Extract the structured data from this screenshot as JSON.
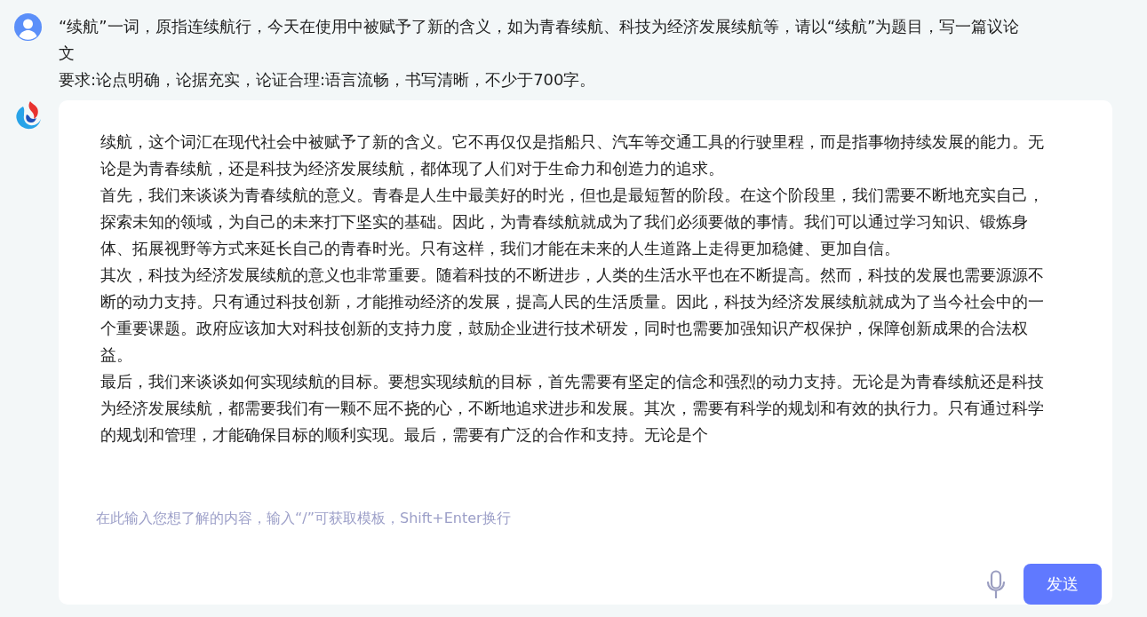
{
  "user_message": {
    "paragraphs": [
      "“续航”一词，原指连续航行，今天在使用中被赋予了新的含义，如为青春续航、科技为经济发展续航等，请以“续航”为题目，写一篇议论文",
      "要求:论点明确，论据充实，论证合理:语言流畅，书写清晰，不少于700字。"
    ]
  },
  "assistant_message": {
    "paragraphs": [
      "续航，这个词汇在现代社会中被赋予了新的含义。它不再仅仅是指船只、汽车等交通工具的行驶里程，而是指事物持续发展的能力。无论是为青春续航，还是科技为经济发展续航，都体现了人们对于生命力和创造力的追求。",
      "首先，我们来谈谈为青春续航的意义。青春是人生中最美好的时光，但也是最短暂的阶段。在这个阶段里，我们需要不断地充实自己，探索未知的领域，为自己的未来打下坚实的基础。因此，为青春续航就成为了我们必须要做的事情。我们可以通过学习知识、锻炼身体、拓展视野等方式来延长自己的青春时光。只有这样，我们才能在未来的人生道路上走得更加稳健、更加自信。",
      "其次，科技为经济发展续航的意义也非常重要。随着科技的不断进步，人类的生活水平也在不断提高。然而，科技的发展也需要源源不断的动力支持。只有通过科技创新，才能推动经济的发展，提高人民的生活质量。因此，科技为经济发展续航就成为了当今社会中的一个重要课题。政府应该加大对科技创新的支持力度，鼓励企业进行技术研发，同时也需要加强知识产权保护，保障创新成果的合法权益。",
      "最后，我们来谈谈如何实现续航的目标。要想实现续航的目标，首先需要有坚定的信念和强烈的动力支持。无论是为青春续航还是科技为经济发展续航，都需要我们有一颗不屈不挠的心，不断地追求进步和发展。其次，需要有科学的规划和有效的执行力。只有通过科学的规划和管理，才能确保目标的顺利实现。最后，需要有广泛的合作和支持。无论是个"
    ]
  },
  "input": {
    "placeholder": "在此输入您想了解的内容，输入“/”可获取模板，Shift+Enter换行"
  },
  "send_button": {
    "label": "发送"
  }
}
